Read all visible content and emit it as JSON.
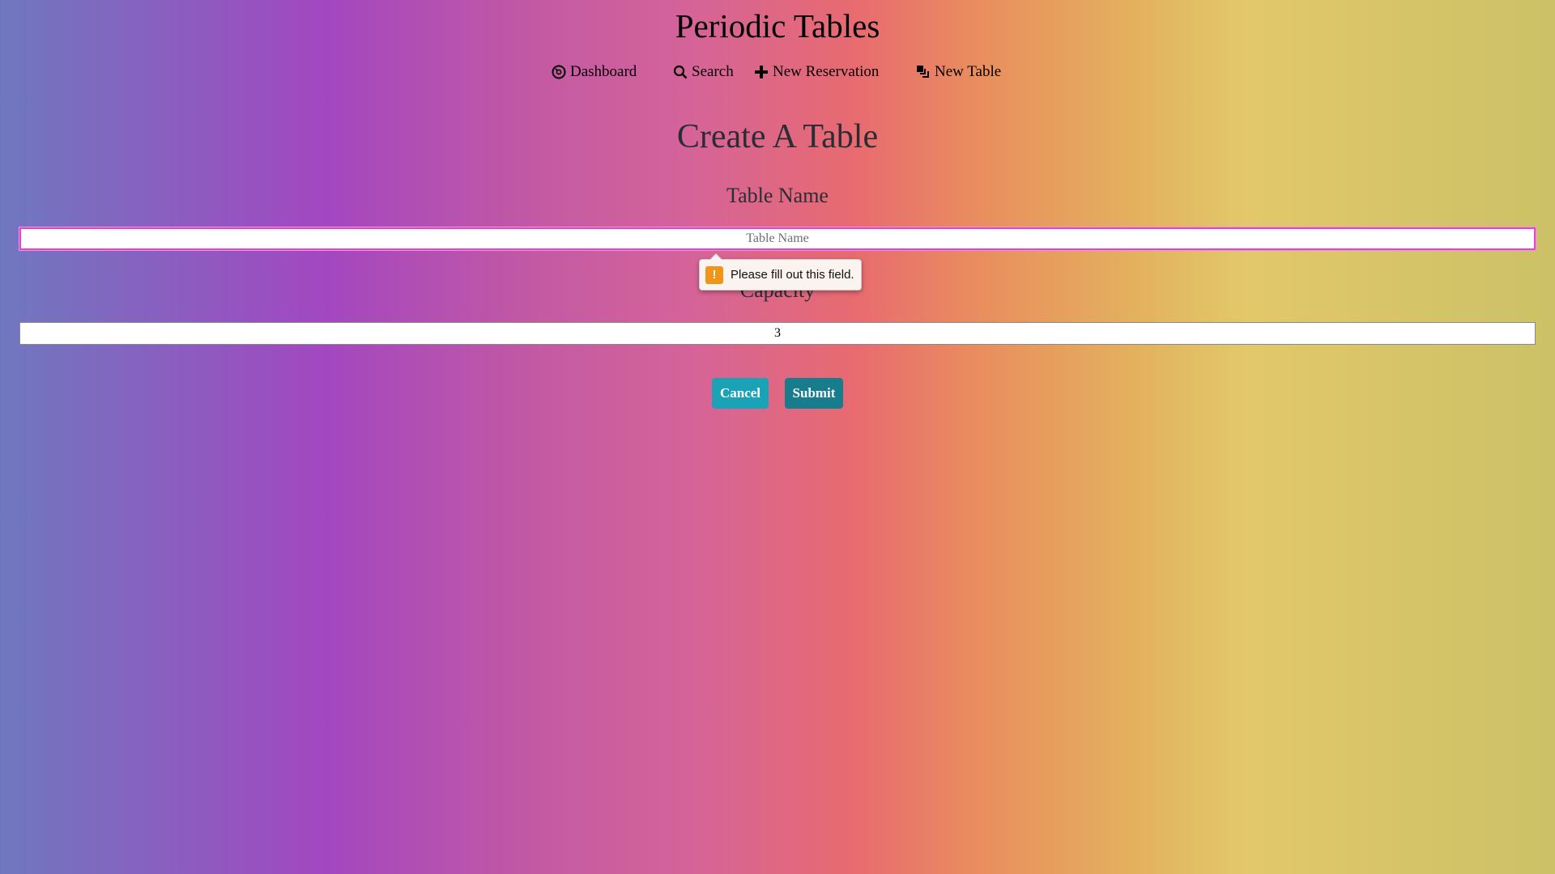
{
  "app": {
    "title": "Periodic Tables"
  },
  "nav": {
    "items": [
      {
        "label": "Dashboard",
        "icon": "dashboard-icon"
      },
      {
        "label": "Search",
        "icon": "search-icon"
      },
      {
        "label": "New Reservation",
        "icon": "plus-icon"
      },
      {
        "label": "New Table",
        "icon": "layers-icon"
      }
    ]
  },
  "form": {
    "heading": "Create A Table",
    "table_name": {
      "label": "Table Name",
      "placeholder": "Table Name",
      "value": ""
    },
    "capacity": {
      "label": "Capacity",
      "value": "3"
    },
    "validation_message": "Please fill out this field.",
    "validation_icon": "warning-icon",
    "cancel_label": "Cancel",
    "submit_label": "Submit"
  },
  "colors": {
    "cancel_button": "#1aa3b6",
    "submit_button": "#177d8c",
    "focus_border": "#e246c8",
    "warning": "#f0951a"
  }
}
